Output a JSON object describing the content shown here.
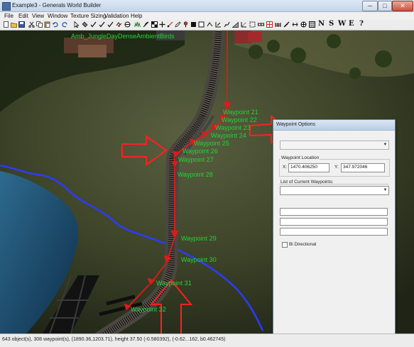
{
  "window": {
    "title": "Example3 - Generals World Builder",
    "min": "─",
    "max": "□",
    "close": "✕"
  },
  "menu": [
    "File",
    "Edit",
    "View",
    "Window",
    "Texture Sizing",
    "Validation",
    "Help"
  ],
  "toolbar": {
    "text_buttons": [
      "N",
      "S",
      "W",
      "E",
      "?"
    ]
  },
  "scene": {
    "sound_label": "Amb_JungleDayDenseAmbientBirds",
    "waypoints": [
      "Waypoint 21",
      "Waypoint 22",
      "Waypoint 23",
      "Waypoint 24",
      "Waypoint 25",
      "Waypoint 26",
      "Waypoint 27",
      "Waypoint 28",
      "Waypoint 29",
      "Waypoint 30",
      "Waypoint 31",
      "Waypoint 32"
    ]
  },
  "dialog": {
    "title": "Waypoint Options",
    "location_label": "Waypoint Location",
    "x_label": "X:",
    "x_value": "1470.406250",
    "y_label": "Y:",
    "y_value": "347.972046",
    "list_label": "List of Current Waypoints:",
    "bidirectional_label": "Bi Directional"
  },
  "status": {
    "text": "643 object(s), 308 waypoint(s), (1890.36,1203.71), height 37.50 (-0.580392), (-0.62...162, b0.462745)"
  },
  "colors": {
    "waypoint_label": "#23d33b",
    "path_arrow": "#e01a1a",
    "highlight_arrow": "#ff2020",
    "river": "#2a3cff"
  }
}
